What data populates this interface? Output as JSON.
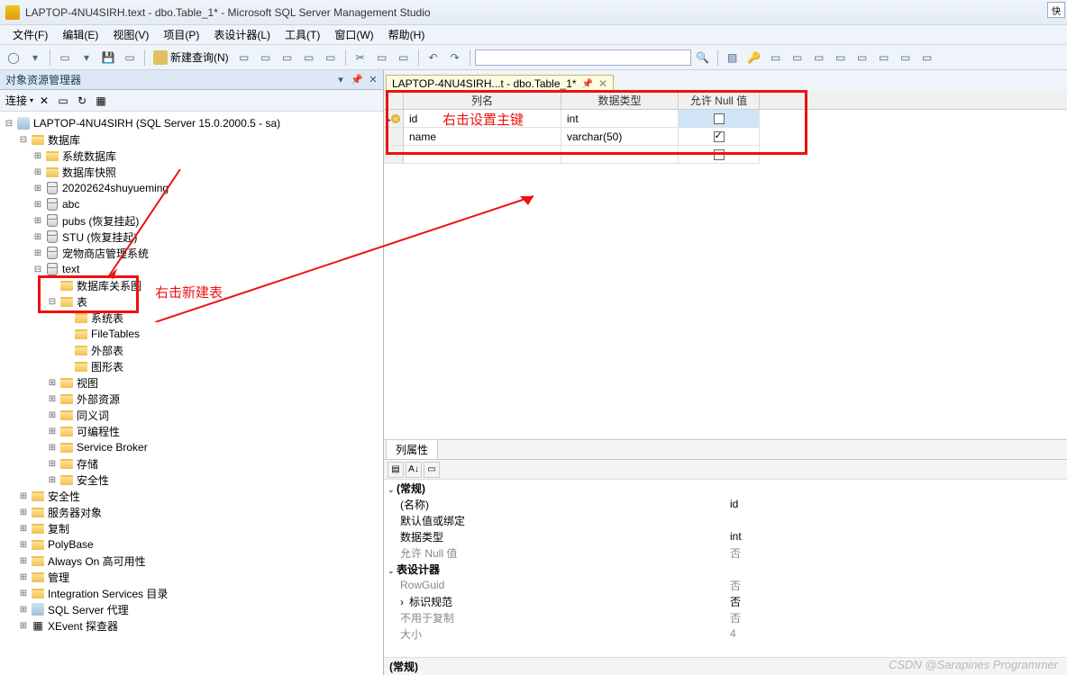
{
  "app": {
    "title": "LAPTOP-4NU4SIRH.text - dbo.Table_1* - Microsoft SQL Server Management Studio",
    "quick": "快"
  },
  "menu": {
    "file": "文件(F)",
    "edit": "编辑(E)",
    "view": "视图(V)",
    "project": "项目(P)",
    "table": "表设计器(L)",
    "tools": "工具(T)",
    "window": "窗口(W)",
    "help": "帮助(H)"
  },
  "toolbar": {
    "newquery": "新建查询(N)"
  },
  "oe": {
    "title": "对象资源管理器",
    "connect": "连接",
    "root": "LAPTOP-4NU4SIRH (SQL Server 15.0.2000.5 - sa)",
    "databases": "数据库",
    "sysdb": "系统数据库",
    "snapshot": "数据库快照",
    "db1": "20202624shuyueming",
    "db2": "abc",
    "db3": "pubs (恢复挂起)",
    "db4": "STU (恢复挂起)",
    "db5": "宠物商店管理系统",
    "db6": "text",
    "diagrams": "数据库关系图",
    "tables": "表",
    "systables": "系统表",
    "filetables": "FileTables",
    "exttables": "外部表",
    "graphtables": "图形表",
    "views": "视图",
    "extres": "外部资源",
    "synonyms": "同义词",
    "prog": "可编程性",
    "sb": "Service Broker",
    "storage": "存储",
    "dbsec": "安全性",
    "security": "安全性",
    "serverobj": "服务器对象",
    "replication": "复制",
    "polybase": "PolyBase",
    "alwayson": "Always On 高可用性",
    "management": "管理",
    "iscat": "Integration Services 目录",
    "agent": "SQL Server 代理",
    "xevent": "XEvent 探查器"
  },
  "annotations": {
    "newtable": "右击新建表",
    "setpk": "右击设置主键"
  },
  "tab": {
    "label": "LAPTOP-4NU4SIRH...t - dbo.Table_1*"
  },
  "colhdr": {
    "name": "列名",
    "type": "数据类型",
    "null": "允许 Null 值"
  },
  "rows": [
    {
      "name": "id",
      "type": "int",
      "null": false,
      "pk": true,
      "sel": true
    },
    {
      "name": "name",
      "type": "varchar(50)",
      "null": true,
      "pk": false,
      "sel": false
    }
  ],
  "props": {
    "title": "列属性",
    "general": "(常规)",
    "name_lbl": "(名称)",
    "name_val": "id",
    "default_lbl": "默认值或绑定",
    "default_val": "",
    "type_lbl": "数据类型",
    "type_val": "int",
    "null_lbl": "允许 Null 值",
    "null_val": "否",
    "designer": "表设计器",
    "rowguid_lbl": "RowGuid",
    "rowguid_val": "否",
    "ident_lbl": "标识规范",
    "ident_val": "否",
    "repl_lbl": "不用于复制",
    "repl_val": "否",
    "size_lbl": "大小",
    "size_val": "4",
    "footer": "(常规)"
  },
  "watermark": "CSDN @Sarapines Programmer"
}
